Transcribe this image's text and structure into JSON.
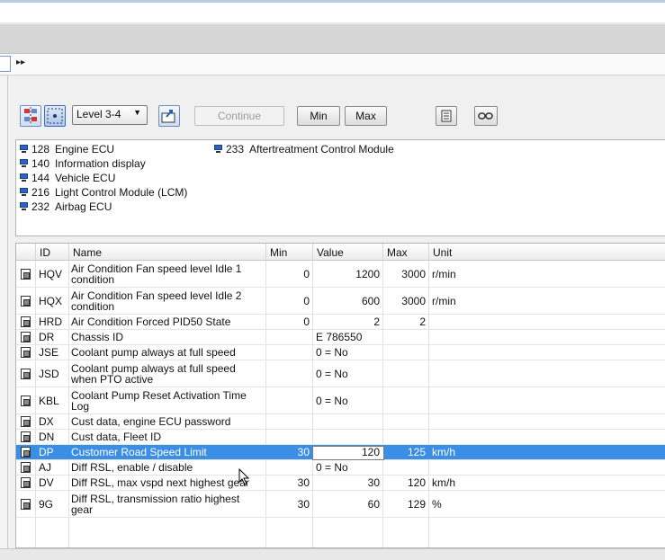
{
  "address": {
    "chevron": "▸▸"
  },
  "toolbar": {
    "level_select": "Level 3-4",
    "continue_label": "Continue",
    "min_label": "Min",
    "max_label": "Max"
  },
  "ecus": [
    {
      "num": "128",
      "name": "Engine ECU"
    },
    {
      "num": "140",
      "name": "Information display"
    },
    {
      "num": "144",
      "name": "Vehicle ECU"
    },
    {
      "num": "216",
      "name": "Light Control Module (LCM)"
    },
    {
      "num": "232",
      "name": "Airbag ECU"
    },
    {
      "num": "233",
      "name": "Aftertreatment Control Module"
    }
  ],
  "table": {
    "columns": [
      "ID",
      "Name",
      "Min",
      "Value",
      "Max",
      "Unit"
    ],
    "rows": [
      {
        "id": "HQV",
        "name": "Air Condition Fan speed level Idle 1 condition",
        "min": "0",
        "value": "1200",
        "max": "3000",
        "unit": "r/min"
      },
      {
        "id": "HQX",
        "name": "Air Condition Fan speed level Idle 2 condition",
        "min": "0",
        "value": "600",
        "max": "3000",
        "unit": "r/min"
      },
      {
        "id": "HRD",
        "name": "Air Condition Forced PID50 State",
        "min": "0",
        "value": "2",
        "max": "2",
        "unit": ""
      },
      {
        "id": "DR",
        "name": "Chassis ID",
        "min": "",
        "value": "E   786550",
        "max": "",
        "unit": ""
      },
      {
        "id": "JSE",
        "name": "Coolant pump always at full speed",
        "min": "",
        "value": "0 = No",
        "max": "",
        "unit": ""
      },
      {
        "id": "JSD",
        "name": "Coolant pump always at full speed when PTO active",
        "min": "",
        "value": "0 = No",
        "max": "",
        "unit": ""
      },
      {
        "id": "KBL",
        "name": "Coolant Pump Reset Activation Time Log",
        "min": "",
        "value": "0 = No",
        "max": "",
        "unit": ""
      },
      {
        "id": "DX",
        "name": "Cust data, engine ECU password",
        "min": "",
        "value": "",
        "max": "",
        "unit": ""
      },
      {
        "id": "DN",
        "name": "Cust data, Fleet ID",
        "min": "",
        "value": "",
        "max": "",
        "unit": ""
      },
      {
        "id": "DP",
        "name": "Customer Road Speed Limit",
        "min": "30",
        "value": "120",
        "max": "125",
        "unit": "km/h"
      },
      {
        "id": "AJ",
        "name": "Diff RSL, enable / disable",
        "min": "",
        "value": "0 = No",
        "max": "",
        "unit": ""
      },
      {
        "id": "DV",
        "name": "Diff RSL, max vspd next highest gear",
        "min": "30",
        "value": "30",
        "max": "120",
        "unit": "km/h"
      },
      {
        "id": "9G",
        "name": "Diff RSL, transmission ratio highest gear",
        "min": "30",
        "value": "60",
        "max": "129",
        "unit": "%"
      }
    ]
  }
}
